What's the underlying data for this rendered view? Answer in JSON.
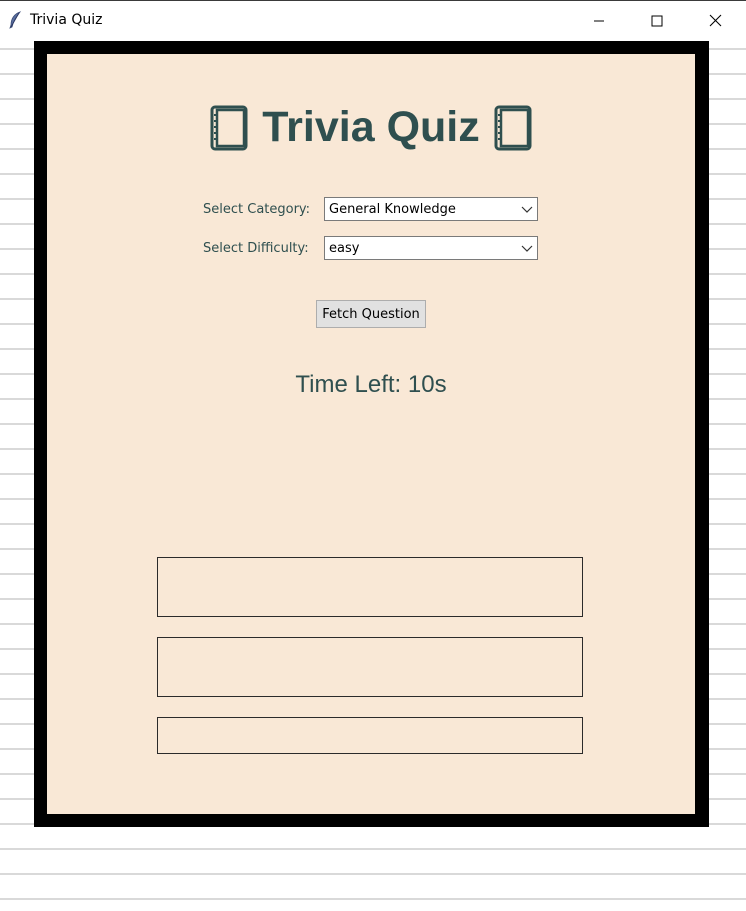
{
  "window": {
    "title": "Trivia Quiz",
    "minimize_icon": "minimize-icon",
    "maximize_icon": "maximize-icon",
    "close_icon": "close-icon",
    "app_icon": "feather-icon"
  },
  "quiz": {
    "heading": "Trivia Quiz",
    "heading_icon": "book-icon",
    "category_label": "Select Category:",
    "category_value": "General Knowledge",
    "difficulty_label": "Select Difficulty:",
    "difficulty_value": "easy",
    "fetch_button": "Fetch Question",
    "timer_text": "Time Left: 10s",
    "answer_buttons": [
      "",
      "",
      ""
    ]
  },
  "colors": {
    "panel_background": "#f9e8d6",
    "frame_border": "#000000",
    "heading_text": "#2f4f4f",
    "button_face": "#e1e1e1"
  }
}
